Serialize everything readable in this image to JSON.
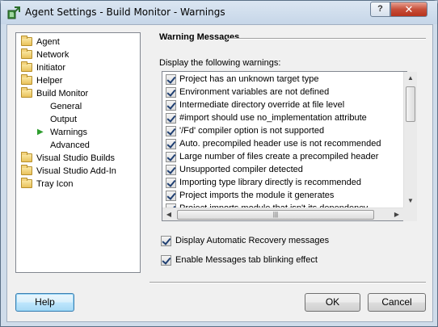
{
  "window": {
    "title": "Agent Settings - Build Monitor - Warnings",
    "help_glyph": "?",
    "close_glyph": "✕"
  },
  "tree": {
    "items": [
      {
        "label": "Agent",
        "type": "folder"
      },
      {
        "label": "Network",
        "type": "folder"
      },
      {
        "label": "Initiator",
        "type": "folder"
      },
      {
        "label": "Helper",
        "type": "folder"
      },
      {
        "label": "Build Monitor",
        "type": "folder-open"
      },
      {
        "label": "General",
        "type": "child"
      },
      {
        "label": "Output",
        "type": "child"
      },
      {
        "label": "Warnings",
        "type": "child-selected",
        "icon": "green-arrow-icon",
        "arrow_glyph": "▶"
      },
      {
        "label": "Advanced",
        "type": "child"
      },
      {
        "label": "Visual Studio Builds",
        "type": "folder"
      },
      {
        "label": "Visual Studio Add-In",
        "type": "folder"
      },
      {
        "label": "Tray Icon",
        "type": "folder"
      }
    ]
  },
  "panel": {
    "group_title": "Warning Messages",
    "list_caption": "Display the following warnings:",
    "warnings": [
      {
        "label": "Project has an unknown target type",
        "checked": true
      },
      {
        "label": "Environment variables are not defined",
        "checked": true
      },
      {
        "label": "Intermediate directory override at file level",
        "checked": true
      },
      {
        "label": "#import should use no_implementation attribute",
        "checked": true
      },
      {
        "label": "'/Fd' compiler option is not supported",
        "checked": true
      },
      {
        "label": "Auto. precompiled header use is not recommended",
        "checked": true
      },
      {
        "label": "Large number of files create a precompiled header",
        "checked": true
      },
      {
        "label": "Unsupported compiler detected",
        "checked": true
      },
      {
        "label": "Importing type library directly is recommended",
        "checked": true
      },
      {
        "label": "Project imports the module it generates",
        "checked": true
      },
      {
        "label": "Project imports module that isn't its dependency",
        "checked": true
      },
      {
        "label": "",
        "checked": true
      }
    ],
    "scroll_glyphs": {
      "up": "▲",
      "down": "▼",
      "left": "◀",
      "right": "▶",
      "grip": "|||"
    },
    "options": [
      {
        "label": "Display Automatic Recovery messages",
        "checked": true
      },
      {
        "label": "Enable Messages tab blinking effect",
        "checked": true
      }
    ]
  },
  "buttons": {
    "help": "Help",
    "ok": "OK",
    "cancel": "Cancel"
  }
}
